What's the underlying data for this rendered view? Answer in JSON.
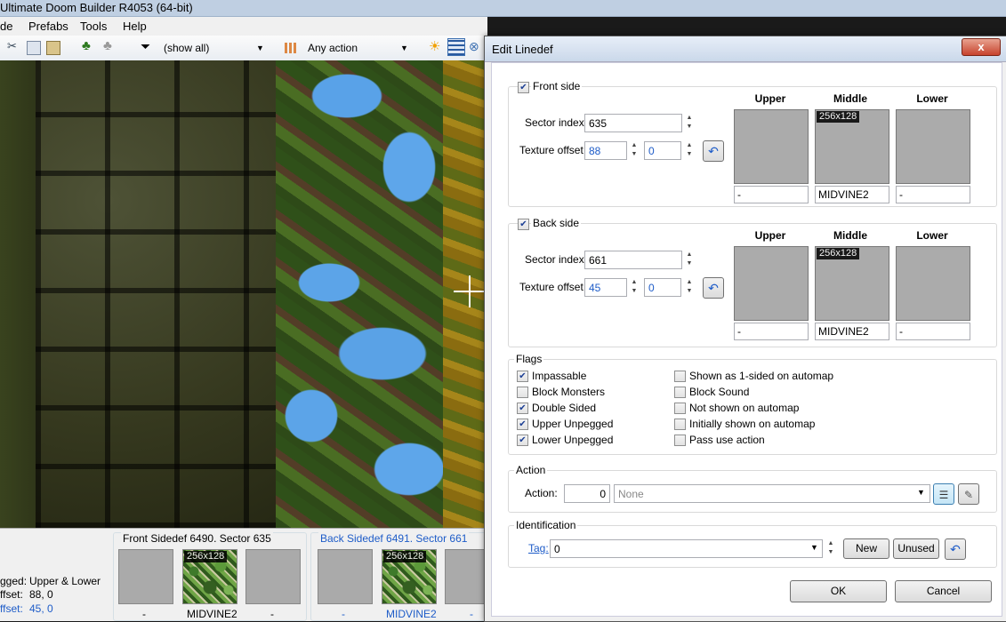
{
  "app": {
    "title": "Ultimate Doom Builder R4053 (64-bit)",
    "menu": [
      "de",
      "Prefabs",
      "Tools",
      "Help"
    ],
    "toolbar": {
      "filter_value": "(show all)",
      "action_value": "Any action"
    }
  },
  "infopanel": {
    "left_lines": [
      {
        "label": "gged:",
        "value": "Upper & Lower"
      },
      {
        "label": "ffset:",
        "value": "88, 0"
      },
      {
        "label": "ffset:",
        "value": "45, 0"
      }
    ],
    "front": {
      "title": "Front Sidedef 6490. Sector 635",
      "textures": [
        {
          "name": "-",
          "size": ""
        },
        {
          "name": "MIDVINE2",
          "size": "256x128"
        },
        {
          "name": "-",
          "size": ""
        }
      ]
    },
    "back": {
      "title": "Back Sidedef 6491. Sector 661",
      "textures": [
        {
          "name": "-",
          "size": ""
        },
        {
          "name": "MIDVINE2",
          "size": "256x128"
        },
        {
          "name": "-",
          "size": ""
        }
      ]
    }
  },
  "dialog": {
    "title": "Edit Linedef",
    "close": "x",
    "tex_headers": [
      "Upper",
      "Middle",
      "Lower"
    ],
    "front": {
      "label": "Front side",
      "checked": true,
      "sector_label": "Sector index:",
      "sector_index": "635",
      "offset_label": "Texture offset:",
      "offset_x": "88",
      "offset_y": "0",
      "textures": [
        {
          "name": "-",
          "size": ""
        },
        {
          "name": "MIDVINE2",
          "size": "256x128"
        },
        {
          "name": "-",
          "size": ""
        }
      ]
    },
    "back": {
      "label": "Back side",
      "checked": true,
      "sector_label": "Sector index:",
      "sector_index": "661",
      "offset_label": "Texture offset:",
      "offset_x": "45",
      "offset_y": "0",
      "textures": [
        {
          "name": "-",
          "size": ""
        },
        {
          "name": "MIDVINE2",
          "size": "256x128"
        },
        {
          "name": "-",
          "size": ""
        }
      ]
    },
    "flags": {
      "label": "Flags",
      "left": [
        {
          "label": "Impassable",
          "checked": true
        },
        {
          "label": "Block Monsters",
          "checked": false
        },
        {
          "label": "Double Sided",
          "checked": true
        },
        {
          "label": "Upper Unpegged",
          "checked": true
        },
        {
          "label": "Lower Unpegged",
          "checked": true
        }
      ],
      "right": [
        {
          "label": "Shown as 1-sided on automap",
          "checked": false
        },
        {
          "label": "Block Sound",
          "checked": false
        },
        {
          "label": "Not shown on automap",
          "checked": false
        },
        {
          "label": "Initially shown on automap",
          "checked": false
        },
        {
          "label": "Pass use action",
          "checked": false
        }
      ]
    },
    "action": {
      "label": "Action",
      "field_label": "Action:",
      "number": "0",
      "value": "None"
    },
    "identification": {
      "label": "Identification",
      "tag_label": "Tag:",
      "tag_value": "0",
      "new_button": "New",
      "unused_button": "Unused"
    },
    "ok_button": "OK",
    "cancel_button": "Cancel"
  }
}
